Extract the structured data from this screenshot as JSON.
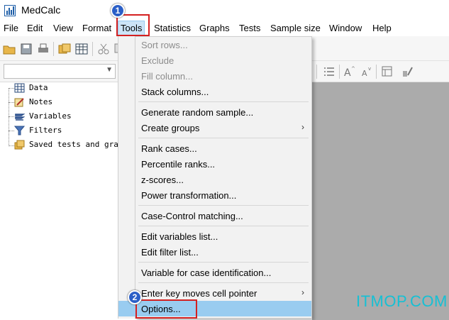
{
  "window": {
    "title": "MedCalc"
  },
  "menubar": {
    "items": [
      "File",
      "Edit",
      "View",
      "Format",
      "Tools",
      "Statistics",
      "Graphs",
      "Tests",
      "Sample size",
      "Window",
      "Help"
    ]
  },
  "tree": {
    "items": [
      {
        "label": "Data",
        "icon": "data-grid-icon"
      },
      {
        "label": "Notes",
        "icon": "notes-icon"
      },
      {
        "label": "Variables",
        "icon": "variables-icon"
      },
      {
        "label": "Filters",
        "icon": "filter-icon"
      },
      {
        "label": "Saved tests and graph",
        "icon": "folder-icon"
      }
    ]
  },
  "tools_menu": {
    "items": [
      {
        "label": "Sort rows...",
        "disabled": true
      },
      {
        "label": "Exclude",
        "disabled": true
      },
      {
        "label": "Fill column...",
        "disabled": true
      },
      {
        "label": "Stack columns..."
      },
      {
        "label": "Generate random sample..."
      },
      {
        "label": "Create groups",
        "submenu": true
      },
      {
        "label": "Rank cases..."
      },
      {
        "label": "Percentile ranks..."
      },
      {
        "label": "z-scores..."
      },
      {
        "label": "Power transformation..."
      },
      {
        "label": "Case-Control matching..."
      },
      {
        "label": "Edit variables list..."
      },
      {
        "label": "Edit filter list..."
      },
      {
        "label": "Variable for case identification..."
      },
      {
        "label": "Enter key moves cell pointer",
        "submenu": true
      },
      {
        "label": "Options...",
        "highlighted": true
      }
    ]
  },
  "callouts": {
    "step1": "1",
    "step2": "2"
  },
  "watermark": "ITMOP.COM",
  "colors": {
    "highlight": "#99ccf0",
    "callout": "#2b5fc7",
    "red_box": "#d42020",
    "workspace": "#ababab",
    "watermark": "#16c0d4"
  }
}
